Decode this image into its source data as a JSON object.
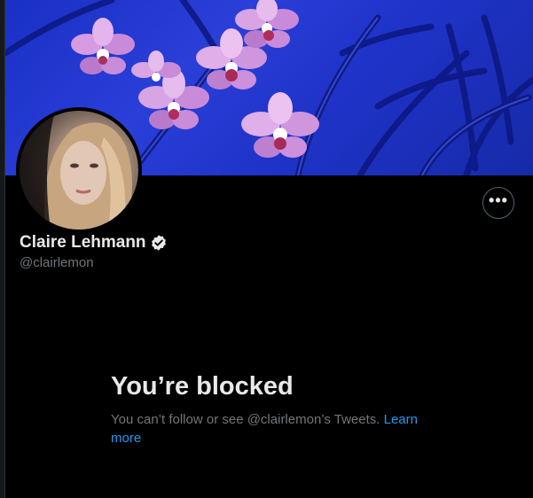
{
  "profile": {
    "display_name": "Claire Lehmann",
    "handle": "@clairlemon",
    "verified_icon": "verified-badge-icon",
    "banner": "blue background with pink orchids",
    "more_icon": "more-options-icon"
  },
  "blocked": {
    "title": "You’re blocked",
    "message": "You can’t follow or see @clairlemon’s Tweets.",
    "link": "Learn more"
  },
  "colors": {
    "background": "#000000",
    "link": "#1d9bf0",
    "secondary_text": "#71767b",
    "primary_text": "#e7e9ea"
  }
}
